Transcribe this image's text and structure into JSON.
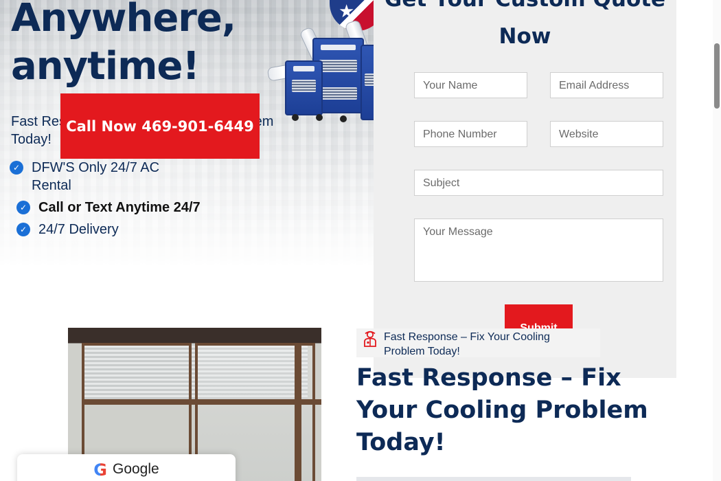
{
  "hero": {
    "title_line1": "Anywhere,",
    "title_line2": "anytime!",
    "subtitle": "Fast Response – Fix Your Cooling Problem Today!",
    "call_button": "Call Now 469-901-6449",
    "features": [
      "DFW'S Only 24/7 AC Rental",
      "Call or Text Anytime 24/7",
      "24/7 Delivery"
    ]
  },
  "form": {
    "title": "Get Your Custom Quote Now",
    "name_placeholder": "Your Name",
    "email_placeholder": "Email Address",
    "phone_placeholder": "Phone Number",
    "website_placeholder": "Website",
    "subject_placeholder": "Subject",
    "message_placeholder": "Your Message",
    "submit_label": "Submit"
  },
  "section": {
    "badge_text": "Fast Response – Fix Your Cooling Problem Today!",
    "title": "Fast Response – Fix Your Cooling Problem Today!"
  },
  "google_widget": {
    "label": "Google",
    "logo_letter": "G"
  },
  "colors": {
    "navy": "#0d2a56",
    "red": "#e3191e",
    "check_blue": "#1a6fd6",
    "form_bg": "#efefef"
  }
}
